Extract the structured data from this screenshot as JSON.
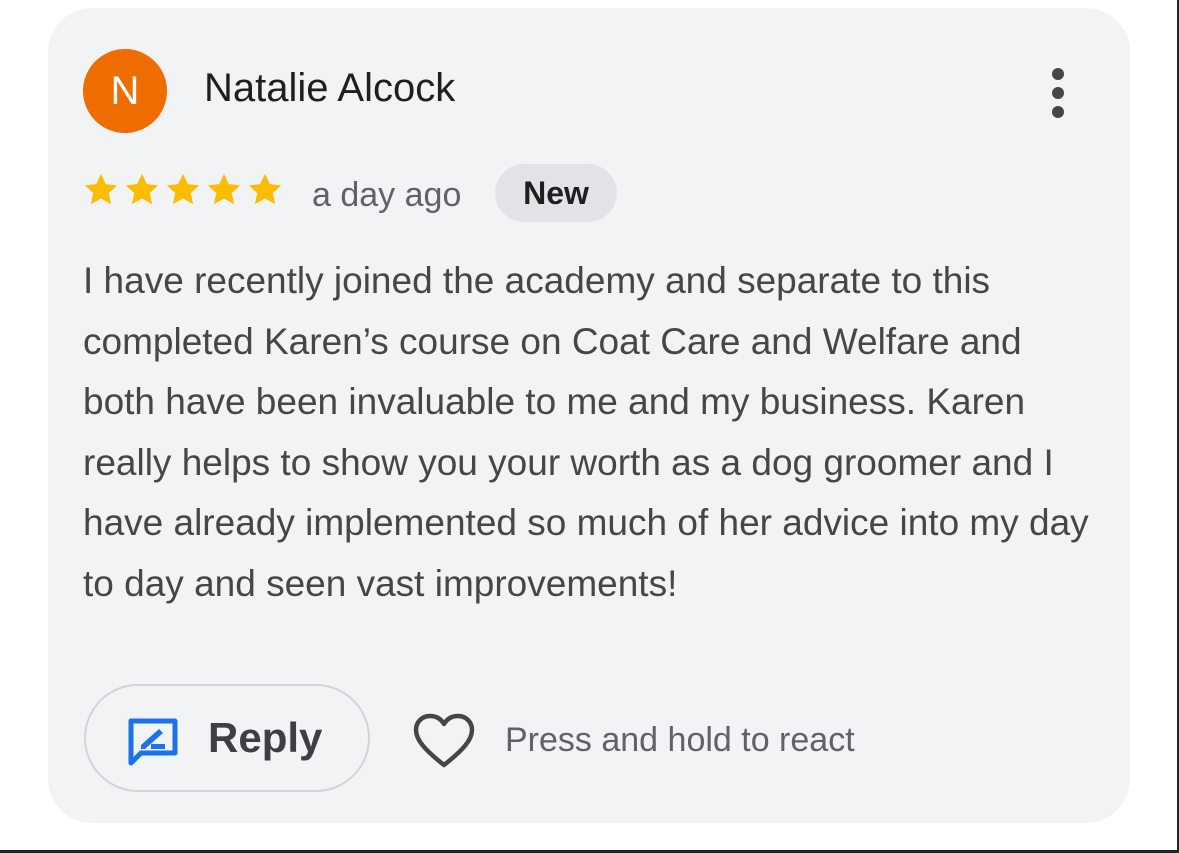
{
  "review": {
    "author_initial": "N",
    "author_name": "Natalie Alcock",
    "rating": 5,
    "rating_max": 5,
    "time_ago": "a day ago",
    "badge": "New",
    "body": "I have recently joined the academy and separate to this completed Karen’s course on Coat Care and Welfare and both have been invaluable to me and my business. Karen really helps to show you your worth as a dog groomer and I have already implemented so much of her advice into my day to day and seen vast improvements!"
  },
  "actions": {
    "reply_label": "Reply",
    "react_hint": "Press and hold to react"
  },
  "icons": {
    "more": "more-vert-icon",
    "star": "star-icon",
    "reply": "reply-edit-icon",
    "react": "heart-outline-icon"
  },
  "colors": {
    "avatar": "#ef6c00",
    "star": "#fbbc04",
    "reply_icon": "#1a73e8",
    "card_bg": "#f2f3f5"
  }
}
